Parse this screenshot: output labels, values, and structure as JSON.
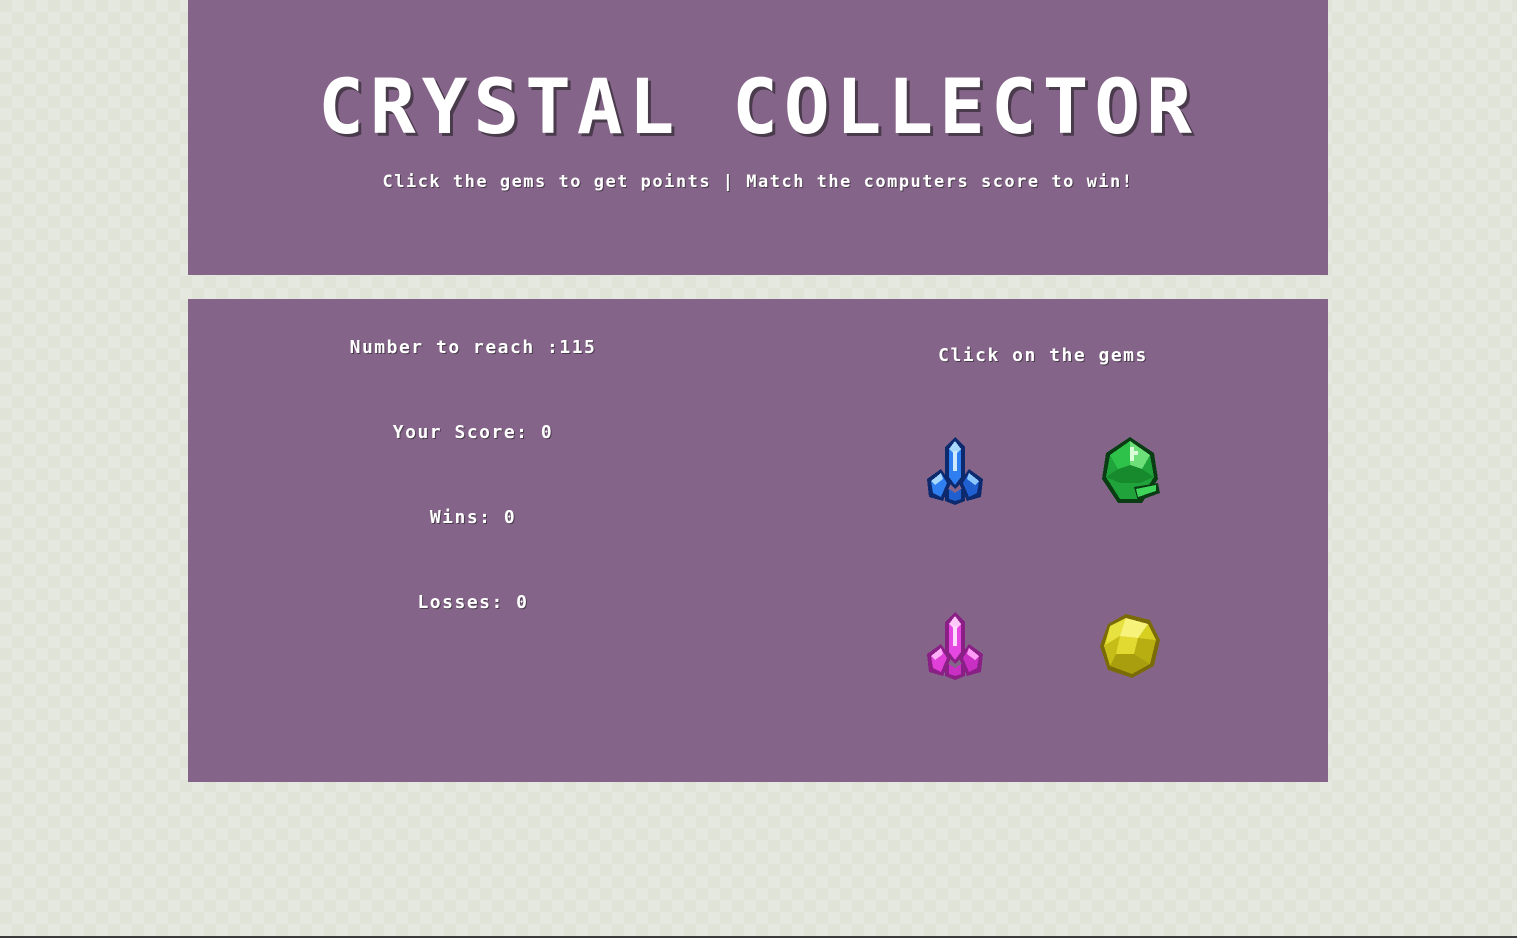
{
  "header": {
    "title": "CRYSTAL COLLECTOR",
    "subtitle": "Click the gems to get points | Match the computers score to win!"
  },
  "stats": {
    "target_label": "Number to reach :115",
    "score_label": "Your Score: 0",
    "wins_label": "Wins: 0",
    "losses_label": "Losses: 0"
  },
  "gems": {
    "heading": "Click on the gems",
    "items": [
      {
        "name": "blue-crystal-icon",
        "color": "#2a6fe0"
      },
      {
        "name": "green-crystal-icon",
        "color": "#1fa33a"
      },
      {
        "name": "pink-crystal-icon",
        "color": "#e03fd8"
      },
      {
        "name": "yellow-crystal-icon",
        "color": "#d8d020"
      }
    ]
  },
  "colors": {
    "panel": "#856489",
    "background": "#dfe3d8",
    "text": "#ffffff"
  }
}
